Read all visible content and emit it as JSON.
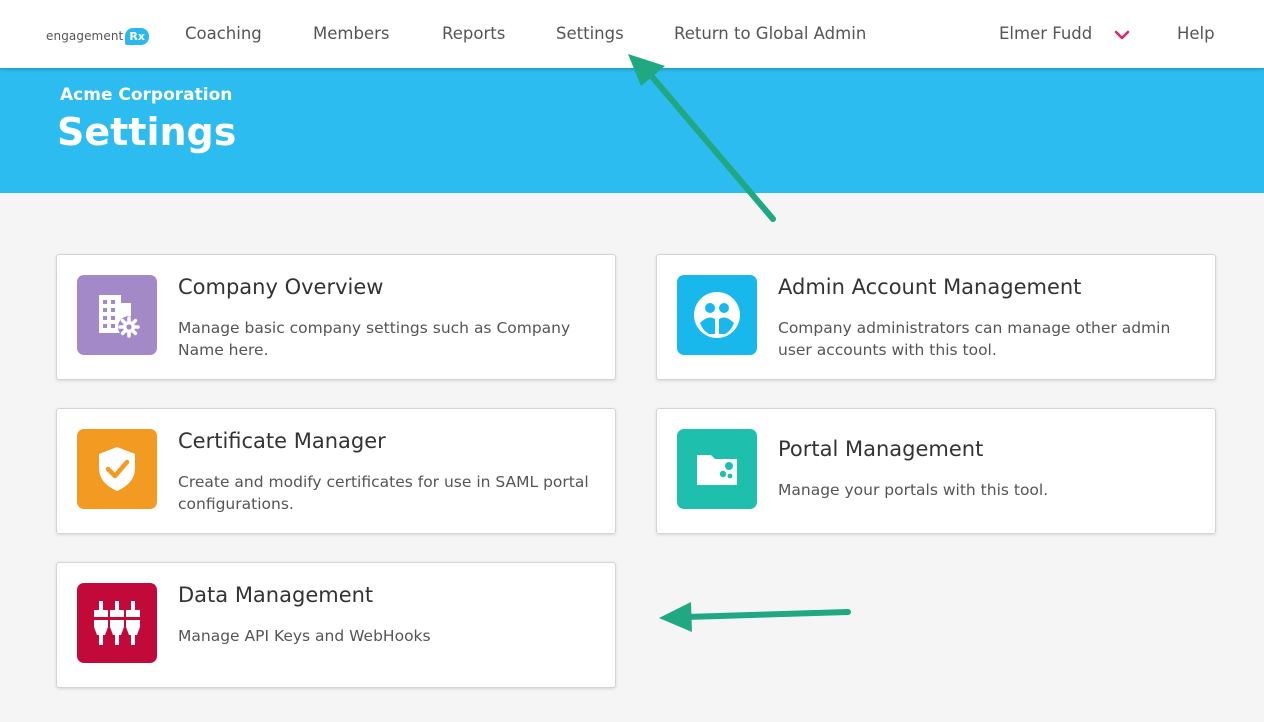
{
  "nav": {
    "logo_text": "engagement",
    "logo_badge": "Rx",
    "links": [
      "Coaching",
      "Members",
      "Reports",
      "Settings",
      "Return to Global Admin"
    ],
    "user": "Elmer Fudd",
    "help": "Help"
  },
  "banner": {
    "org": "Acme Corporation",
    "title": "Settings"
  },
  "cards": [
    {
      "title": "Company Overview",
      "desc": "Manage basic company settings such as Company Name here.",
      "color": "#a389c8",
      "icon": "building-gear-icon"
    },
    {
      "title": "Admin Account Management",
      "desc": "Company administrators can manage other admin user accounts with this tool.",
      "color": "#18b8ec",
      "icon": "users-circle-icon"
    },
    {
      "title": "Certificate Manager",
      "desc": "Create and modify certificates for use in SAML portal configurations.",
      "color": "#f29a22",
      "icon": "shield-check-icon"
    },
    {
      "title": "Portal Management",
      "desc": "Manage your portals with this tool.",
      "color": "#1fbfae",
      "icon": "folder-dots-icon"
    },
    {
      "title": "Data Management",
      "desc": "Manage API Keys and WebHooks",
      "color": "#c20a3a",
      "icon": "connectors-icon"
    }
  ],
  "colors": {
    "banner": "#2dbcf0",
    "annotation_arrow": "#1fa882",
    "chevron": "#e0245e"
  }
}
